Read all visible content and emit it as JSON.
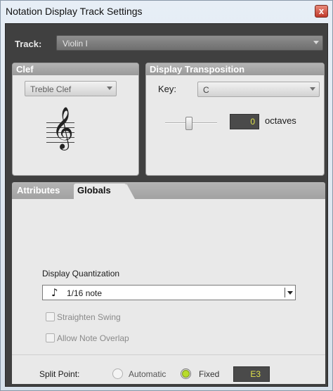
{
  "window": {
    "title": "Notation Display Track Settings",
    "close_glyph": "x"
  },
  "track": {
    "label": "Track:",
    "value": "Violin I"
  },
  "clef": {
    "heading": "Clef",
    "value": "Treble Clef",
    "glyph": "𝄞"
  },
  "transposition": {
    "heading": "Display Transposition",
    "key_label": "Key:",
    "key_value": "C",
    "octaves_value": "0",
    "octaves_label": "octaves"
  },
  "tabs": [
    {
      "label": "Attributes",
      "active": false
    },
    {
      "label": "Globals",
      "active": true
    }
  ],
  "globals": {
    "display_quantization_label": "Display Quantization",
    "quantization_value": "1/16 note",
    "note_glyph": "♪",
    "straighten_swing_label": "Straighten Swing",
    "allow_note_overlap_label": "Allow Note Overlap",
    "split_point_label": "Split Point:",
    "automatic_label": "Automatic",
    "fixed_label": "Fixed",
    "split_value": "E3",
    "split_mode": "Fixed"
  },
  "colors": {
    "accent_radio": "#b8dc2a",
    "value_text": "#e0e34a"
  }
}
